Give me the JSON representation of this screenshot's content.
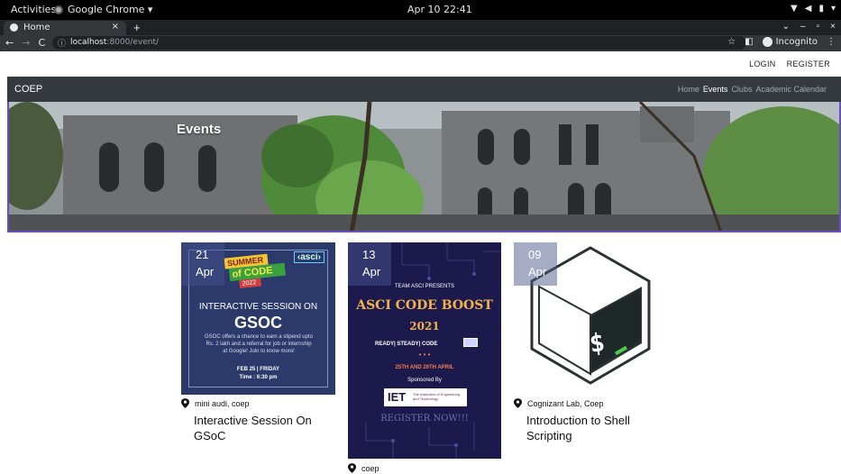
{
  "system": {
    "activities": "Activities",
    "app_name": "Google Chrome ▾",
    "clock": "Apr 10  22:41"
  },
  "browser": {
    "tab_title": "Home",
    "tab_close": "×",
    "new_tab": "+",
    "back": "←",
    "forward": "→",
    "reload": "C",
    "url_host": "localhost",
    "url_path": ":8000/event/",
    "incognito_label": "Incognito",
    "star": "☆",
    "menu": "⋮"
  },
  "site": {
    "login": "LOGIN",
    "register": "REGISTER",
    "brand": "COEP",
    "nav": [
      "Home",
      "Events",
      "Clubs",
      "Academic Calendar"
    ],
    "hero_title": "Events"
  },
  "events": [
    {
      "day": "21",
      "month": "Apr",
      "location": "mini audi, coep",
      "title": "Interactive Session On GSoC",
      "poster": {
        "badge": "‹asci›",
        "brand_top": "SUMMER",
        "brand_mid": "of CODE",
        "brand_year": "2022",
        "headline": "INTERACTIVE  SESSION ON",
        "headline2": "GSOC",
        "body": "GSOC offers a chance to earn a stipend upto Rs. 2 lakh and a referral for job or internship at Google! Join to know more!",
        "date": "FEB 25 | FRIDAY",
        "time": "Time : 6:30 pm"
      }
    },
    {
      "day": "13",
      "month": "Apr",
      "location": "coep",
      "title": "",
      "poster": {
        "team": "TEAM ASCI PRESENTS",
        "title": "ASCI CODE BOOST",
        "year": "2021",
        "tagline": "READY| STEADY| CODE",
        "dates": "25TH AND 26TH APRIL",
        "sponsored": "Sponsored By",
        "sponsor": "IET",
        "sponsor_sub": "The Institution of Engineering and Technology",
        "register": "REGISTER NOW!!!"
      }
    },
    {
      "day": "09",
      "month": "Apr",
      "location": "Cognizant Lab, Coep",
      "title": "Introduction to Shell Scripting",
      "poster": {
        "prompt": "$"
      }
    }
  ],
  "colors": {
    "navbar": "#343a40",
    "poster1_bg": "#2b3a6b",
    "poster2_bg": "#1c1a4d",
    "date_overlay": "rgba(70,80,140,0.55)"
  }
}
